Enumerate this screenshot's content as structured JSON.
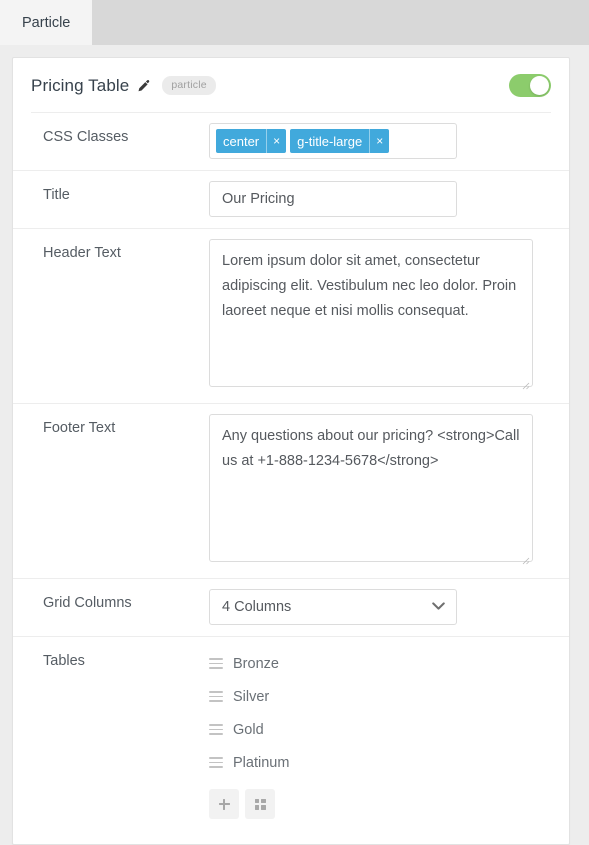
{
  "tabs": [
    {
      "label": "Particle",
      "active": true
    }
  ],
  "card": {
    "title": "Pricing Table",
    "edit_icon": "pencil-icon",
    "badge": "particle",
    "enabled_toggle": {
      "state": "on",
      "color": "#8ccc6c"
    }
  },
  "fields": {
    "css_classes": {
      "label": "CSS Classes",
      "tags": [
        {
          "text": "center",
          "remove": "×"
        },
        {
          "text": "g-title-large",
          "remove": "×"
        }
      ],
      "tag_color": "#41a9dc"
    },
    "title": {
      "label": "Title",
      "value": "Our Pricing",
      "placeholder": ""
    },
    "header_text": {
      "label": "Header Text",
      "value": "Lorem ipsum dolor sit amet, consectetur adipiscing elit. Vestibulum nec leo dolor. Proin laoreet neque et nisi mollis consequat.",
      "placeholder": ""
    },
    "footer_text": {
      "label": "Footer Text",
      "value": "Any questions about our pricing? <strong>Call us at +1-888-1234-5678</strong>",
      "placeholder": ""
    },
    "grid_columns": {
      "label": "Grid Columns",
      "value": "4 Columns",
      "chevron_icon": "chevron-down-icon"
    },
    "tables": {
      "label": "Tables",
      "items": [
        {
          "name": "Bronze",
          "handle_icon": "drag-handle-icon"
        },
        {
          "name": "Silver",
          "handle_icon": "drag-handle-icon"
        },
        {
          "name": "Gold",
          "handle_icon": "drag-handle-icon"
        },
        {
          "name": "Platinum",
          "handle_icon": "drag-handle-icon"
        }
      ],
      "actions": [
        {
          "name": "add-item-button",
          "icon": "plus-icon"
        },
        {
          "name": "grid-view-button",
          "icon": "grid-icon"
        }
      ]
    }
  }
}
